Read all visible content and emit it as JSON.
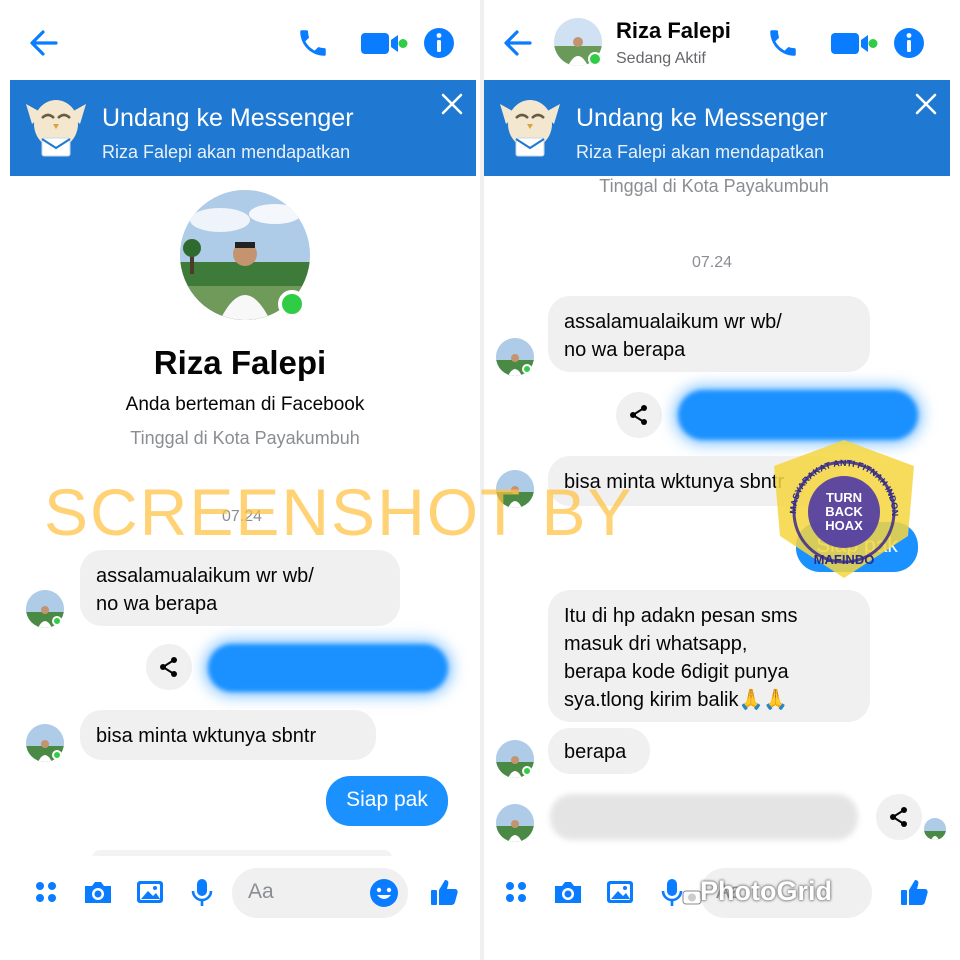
{
  "contact": {
    "name": "Riza Falepi",
    "status": "Sedang Aktif"
  },
  "banner": {
    "title": "Undang ke Messenger",
    "subtitle": "Riza Falepi akan mendapatkan"
  },
  "profile": {
    "name": "Riza Falepi",
    "friends_text": "Anda berteman di Facebook",
    "location_text": "Tinggal di Kota Payakumbuh"
  },
  "time_label": "07.24",
  "messages_left": [
    {
      "from": "contact",
      "text": "assalamualaikum wr wb/\nno wa berapa"
    },
    {
      "from": "me",
      "blurred": true
    },
    {
      "from": "contact",
      "text": "bisa minta wktunya sbntr"
    },
    {
      "from": "me",
      "text": "Siap pak"
    }
  ],
  "messages_right": [
    {
      "from": "contact",
      "text": "assalamualaikum wr wb/\nno wa berapa"
    },
    {
      "from": "me",
      "blurred": true
    },
    {
      "from": "contact",
      "text": "bisa minta wktunya sbntr"
    },
    {
      "from": "me",
      "text": "Siap pak"
    },
    {
      "from": "contact",
      "text": "Itu di hp adakn pesan sms\nmasuk dri whatsapp,\nberapa kode 6digit punya\nsya.tlong kirim balik🙏🙏"
    },
    {
      "from": "contact",
      "text": "berapa"
    },
    {
      "from": "contact",
      "blurred": true
    }
  ],
  "composer": {
    "placeholder": "Aa"
  },
  "watermark_text": "SCREENSHOT BY",
  "badge": {
    "ring_text": "MASYARAKAT ANTI FITNAH INDONESIA",
    "center_lines": [
      "TURN",
      "BACK",
      "HOAX"
    ],
    "bottom_text": "MAFINDO"
  },
  "photogrid_text": "PhotoGrid",
  "colors": {
    "messenger_blue": "#0a7cff",
    "outgoing_bubble": "#1a91ff",
    "banner_blue": "#1f78d1",
    "incoming_bubble": "#f0f0f0",
    "online_green": "#31cc46",
    "watermark_orange": "#ffc040"
  }
}
